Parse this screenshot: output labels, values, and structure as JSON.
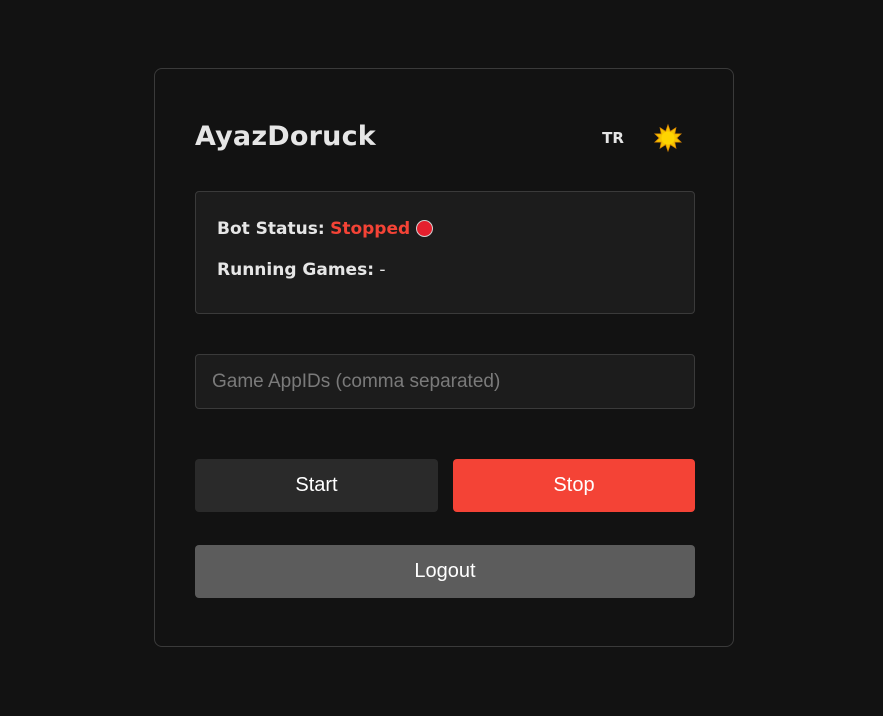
{
  "header": {
    "title": "AyazDoruck",
    "language_label": "TR",
    "theme_icon": "sun-icon"
  },
  "status": {
    "bot_status_label": "Bot Status:",
    "bot_status_value": "Stopped",
    "bot_status_color": "#f44336",
    "indicator_color": "#e5202e",
    "running_games_label": "Running Games:",
    "running_games_value": "-"
  },
  "appids_input": {
    "value": "",
    "placeholder": "Game AppIDs (comma separated)"
  },
  "actions": {
    "start_label": "Start",
    "stop_label": "Stop",
    "logout_label": "Logout"
  },
  "colors": {
    "background": "#121212",
    "panel": "#1c1c1c",
    "accent_red": "#f44336",
    "start_button": "#2a2a2a",
    "logout_button": "#5c5c5c",
    "sun": "#f5c400"
  }
}
